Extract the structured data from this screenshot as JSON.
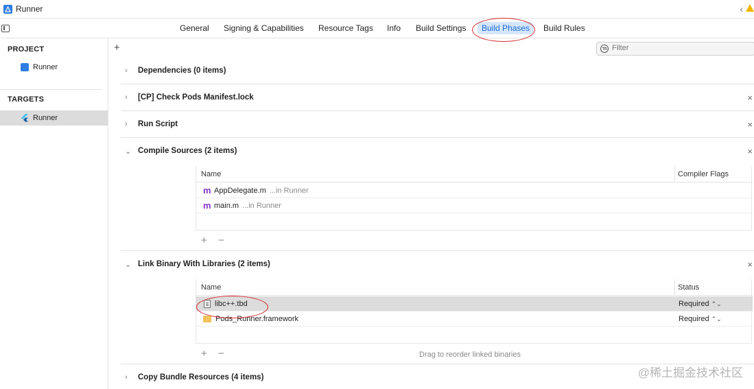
{
  "window": {
    "title": "Runner"
  },
  "tabs": [
    {
      "label": "General"
    },
    {
      "label": "Signing & Capabilities"
    },
    {
      "label": "Resource Tags"
    },
    {
      "label": "Info"
    },
    {
      "label": "Build Settings"
    },
    {
      "label": "Build Phases",
      "active": true
    },
    {
      "label": "Build Rules"
    }
  ],
  "sidebar": {
    "project_heading": "PROJECT",
    "project_item": "Runner",
    "targets_heading": "TARGETS",
    "target_item": "Runner"
  },
  "filter": {
    "placeholder": "Filter",
    "add_label": "+"
  },
  "phases": {
    "dependencies": "Dependencies (0 items)",
    "check_pods": "[CP] Check Pods Manifest.lock",
    "run_script": "Run Script",
    "compile_sources": {
      "title": "Compile Sources (2 items)",
      "col_name": "Name",
      "col_flags": "Compiler Flags",
      "rows": [
        {
          "icon": "m",
          "name": "AppDelegate.m",
          "location": "...in Runner"
        },
        {
          "icon": "m",
          "name": "main.m",
          "location": "...in Runner"
        }
      ],
      "add": "+",
      "remove": "−"
    },
    "link_binary": {
      "title": "Link Binary With Libraries (2 items)",
      "col_name": "Name",
      "col_status": "Status",
      "rows": [
        {
          "name": "libc++.tbd",
          "status": "Required"
        },
        {
          "name": "Pods_Runner.framework",
          "status": "Required"
        }
      ],
      "add": "+",
      "remove": "−",
      "hint": "Drag to reorder linked binaries"
    },
    "copy_bundle": "Copy Bundle Resources (4 items)"
  },
  "glyphs": {
    "chevron_right": "›",
    "chevron_down": "⌄",
    "close": "×",
    "up_down": "⌃⌄",
    "back": "‹"
  },
  "watermark": "@稀土掘金技术社区",
  "colors": {
    "accent": "#1a6ad6",
    "annotation": "#d9262a",
    "selection": "#dcdcdc"
  }
}
